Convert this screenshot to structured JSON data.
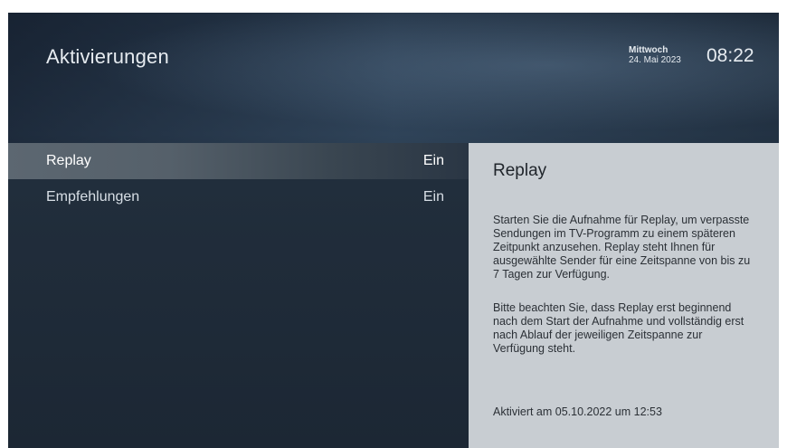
{
  "header": {
    "title": "Aktivierungen",
    "weekday": "Mittwoch",
    "date": "24. Mai 2023",
    "time": "08:22"
  },
  "list": {
    "items": [
      {
        "label": "Replay",
        "value": "Ein",
        "selected": true
      },
      {
        "label": "Empfehlungen",
        "value": "Ein",
        "selected": false
      }
    ]
  },
  "detail": {
    "title": "Replay",
    "paragraph1": "Starten Sie die Aufnahme für Replay, um verpasste Sendungen im TV-Programm zu einem späteren Zeitpunkt anzusehen. Replay steht Ihnen für ausgewählte Sender für eine Zeitspanne von bis zu 7 Tagen zur Verfügung.",
    "paragraph2": "Bitte beachten Sie, dass Replay erst beginnend nach dem Start der Aufnahme und vollständig erst nach Ablauf der jeweiligen Zeitspanne zur Verfügung steht.",
    "footer": "Aktiviert am 05.10.2022 um 12:53"
  },
  "colors": {
    "detail_background": "#c8cdd2",
    "selected_row": "#5c6771",
    "panel_background": "#1f2b38"
  }
}
